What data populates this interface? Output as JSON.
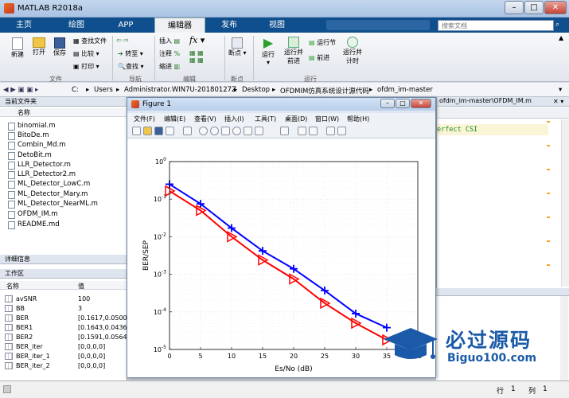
{
  "window": {
    "title": "MATLAB R2018a",
    "search_placeholder": "搜索文档"
  },
  "ribbon_tabs": [
    "主页",
    "绘图",
    "APP",
    "编辑器",
    "发布",
    "视图"
  ],
  "ribbon": {
    "file": {
      "new": "新建",
      "open": "打开",
      "save": "保存",
      "find_files": "查找文件",
      "compare": "比较",
      "print": "打印",
      "group": "文件"
    },
    "nav": {
      "goto": "转至",
      "find": "查找",
      "group": "导航"
    },
    "edit": {
      "insert": "插入",
      "comment": "注释",
      "indent": "缩进",
      "group": "编辑"
    },
    "breakpoints": {
      "label": "断点",
      "group": "断点"
    },
    "run": {
      "run": "运行",
      "run_advance_1": "运行并",
      "run_advance_2": "前进",
      "run_section": "运行节",
      "advance": "前进",
      "run_time_1": "运行并",
      "run_time_2": "计时",
      "group": "运行"
    }
  },
  "path": {
    "segments": [
      "C:",
      "Users",
      "Administrator.WIN7U-20180127Z",
      "Desktop",
      "OFDMIM仿真系统设计源代码",
      "ofdm_im-master"
    ]
  },
  "current_folder": {
    "header": "当前文件夹",
    "col_name": "名称",
    "files": [
      "binomial.m",
      "BitoDe.m",
      "Combin_Md.m",
      "DetoBit.m",
      "LLR_Detector.m",
      "LLR_Detector2.m",
      "ML_Detector_LowC.m",
      "ML_Detector_Mary.m",
      "ML_Detector_NearML.m",
      "OFDM_IM.m",
      "README.md"
    ]
  },
  "details": {
    "header": "详细信息"
  },
  "workspace": {
    "header": "工作区",
    "col_name": "名称",
    "col_value": "值",
    "vars": [
      {
        "name": "avSNR",
        "value": "100"
      },
      {
        "name": "BB",
        "value": "3"
      },
      {
        "name": "BER",
        "value": "[0.1617,0.0500,0"
      },
      {
        "name": "BER1",
        "value": "[0.1643,0.0436,0"
      },
      {
        "name": "BER2",
        "value": "[0.1591,0.0564,0"
      },
      {
        "name": "BER_iter",
        "value": "[0,0,0,0]"
      },
      {
        "name": "BER_iter_1",
        "value": "[0,0,0,0]"
      },
      {
        "name": "BER_iter_2",
        "value": "[0,0,0,0]"
      }
    ]
  },
  "editor": {
    "tab_path": "ofdm_im-master\\OFDM_IM.m",
    "code_snippet": "erfect CSI"
  },
  "status": {
    "row_label": "行",
    "row_value": "1",
    "col_label": "列",
    "col_value": "1"
  },
  "figure": {
    "title": "Figure 1",
    "menu": [
      "文件(F)",
      "编辑(E)",
      "查看(V)",
      "插入(I)",
      "工具(T)",
      "桌面(D)",
      "窗口(W)",
      "帮助(H)"
    ]
  },
  "chart_data": {
    "type": "line",
    "xlabel": "Es/No (dB)",
    "ylabel": "BER/SEP",
    "xlim": [
      0,
      40
    ],
    "ylim": [
      1e-05,
      1
    ],
    "yscale": "log",
    "grid": true,
    "x_ticks": [
      "0",
      "5",
      "10",
      "15",
      "20",
      "25",
      "30",
      "35",
      "40"
    ],
    "y_ticks": [
      "10^0",
      "10^-1",
      "10^-2",
      "10^-3",
      "10^-4",
      "10^-5"
    ],
    "series": [
      {
        "color": "#0000ff",
        "marker": "plus",
        "x": [
          0,
          5,
          10,
          15,
          20,
          25,
          30,
          35
        ],
        "values": [
          0.25,
          0.075,
          0.017,
          0.0042,
          0.0014,
          0.00037,
          9e-05,
          3.8e-05
        ]
      },
      {
        "color": "#ff0000",
        "marker": "triangle-right",
        "x": [
          0,
          5,
          10,
          15,
          20,
          25,
          30,
          35
        ],
        "values": [
          0.165,
          0.05,
          0.01,
          0.0024,
          0.00075,
          0.00017,
          5e-05,
          1.8e-05
        ]
      }
    ]
  },
  "watermark": {
    "text_cn": "必过源码",
    "text_url": "Biguo100.com"
  },
  "colors": {
    "ribbon_tab_bg": "#0f4f8d",
    "watermark_blue": "#1a5aa8"
  }
}
